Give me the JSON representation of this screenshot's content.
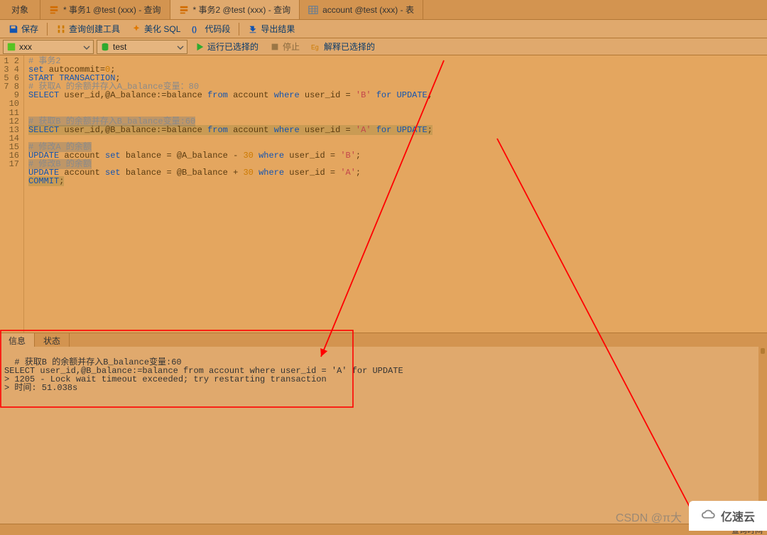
{
  "tabs": {
    "objects": "对象",
    "items": [
      {
        "label": "* 事务1 @test (xxx) - 查询",
        "type": "query",
        "active": false
      },
      {
        "label": "* 事务2 @test (xxx) - 查询",
        "type": "query",
        "active": true
      },
      {
        "label": "account @test (xxx) - 表",
        "type": "table",
        "active": false
      }
    ]
  },
  "toolbar": {
    "save": "保存",
    "builder": "查询创建工具",
    "beautify": "美化 SQL",
    "snippet": "代码段",
    "export": "导出结果"
  },
  "conn": {
    "server_icon_color": "#58c322",
    "server": "xxx",
    "db_icon_color": "#2faa2f",
    "db": "test",
    "run": "运行已选择的",
    "stop": "停止",
    "explain": "解释已选择的"
  },
  "editor": {
    "line_count": 17,
    "code_html": "<span class='cm'># 事务2</span>\n<span class='kw'>set</span> autocommit=<span class='num'>0</span>;\n<span class='kw'>START TRANSACTION</span>;\n<span class='cm'># 获取A 的余额并存入A_balance变量：80</span>\n<span class='kw'>SELECT</span> user_id,@A_balance:=balance <span class='kw'>from</span> account <span class='kw'>where</span> user_id = <span class='str'>'B'</span> <span class='kw'>for</span> <span class='kw'>UPDATE</span>;\n\n\n<span class='hlg'><span class='cm'># 获取B 的余额并存入B_balance变量:60</span></span>\n<span class='hl'><span class='kw'>SELECT</span> user_id,@B_balance:=balance <span class='kw'>from</span> account <span class='kw'>where</span> user_id = <span class='str'>'A'</span> <span class='kw'>for</span> <span class='kw'>UPDATE</span>;</span>\n\n<span class='hlg'><span class='cm'># 修改A 的余额</span></span>\n<span class='kw'>UPDATE</span> account <span class='kw'>set</span> balance = @A_balance - <span class='num'>30</span> <span class='kw'>where</span> user_id = <span class='str'>'B'</span>;\n<span class='hlg'><span class='cm'># 修改B 的余额</span></span>\n<span class='kw'>UPDATE</span> account <span class='kw'>set</span> balance = @B_balance + <span class='num'>30</span> <span class='kw'>where</span> user_id = <span class='str'>'A'</span>;\n<span class='hl'><span class='kw'>COMMIT</span>;</span>\n\n"
  },
  "bottom": {
    "tab_info": "信息",
    "tab_state": "状态",
    "output": "# 获取B 的余额并存入B_balance变量:60\nSELECT user_id,@B_balance:=balance from account where user_id = 'A' for UPDATE\n> 1205 - Lock wait timeout exceeded; try restarting transaction\n> 时间: 51.038s"
  },
  "status": {
    "right": "查询时间"
  },
  "watermark": {
    "csdn": "CSDN @π大",
    "yisu": "亿速云"
  }
}
